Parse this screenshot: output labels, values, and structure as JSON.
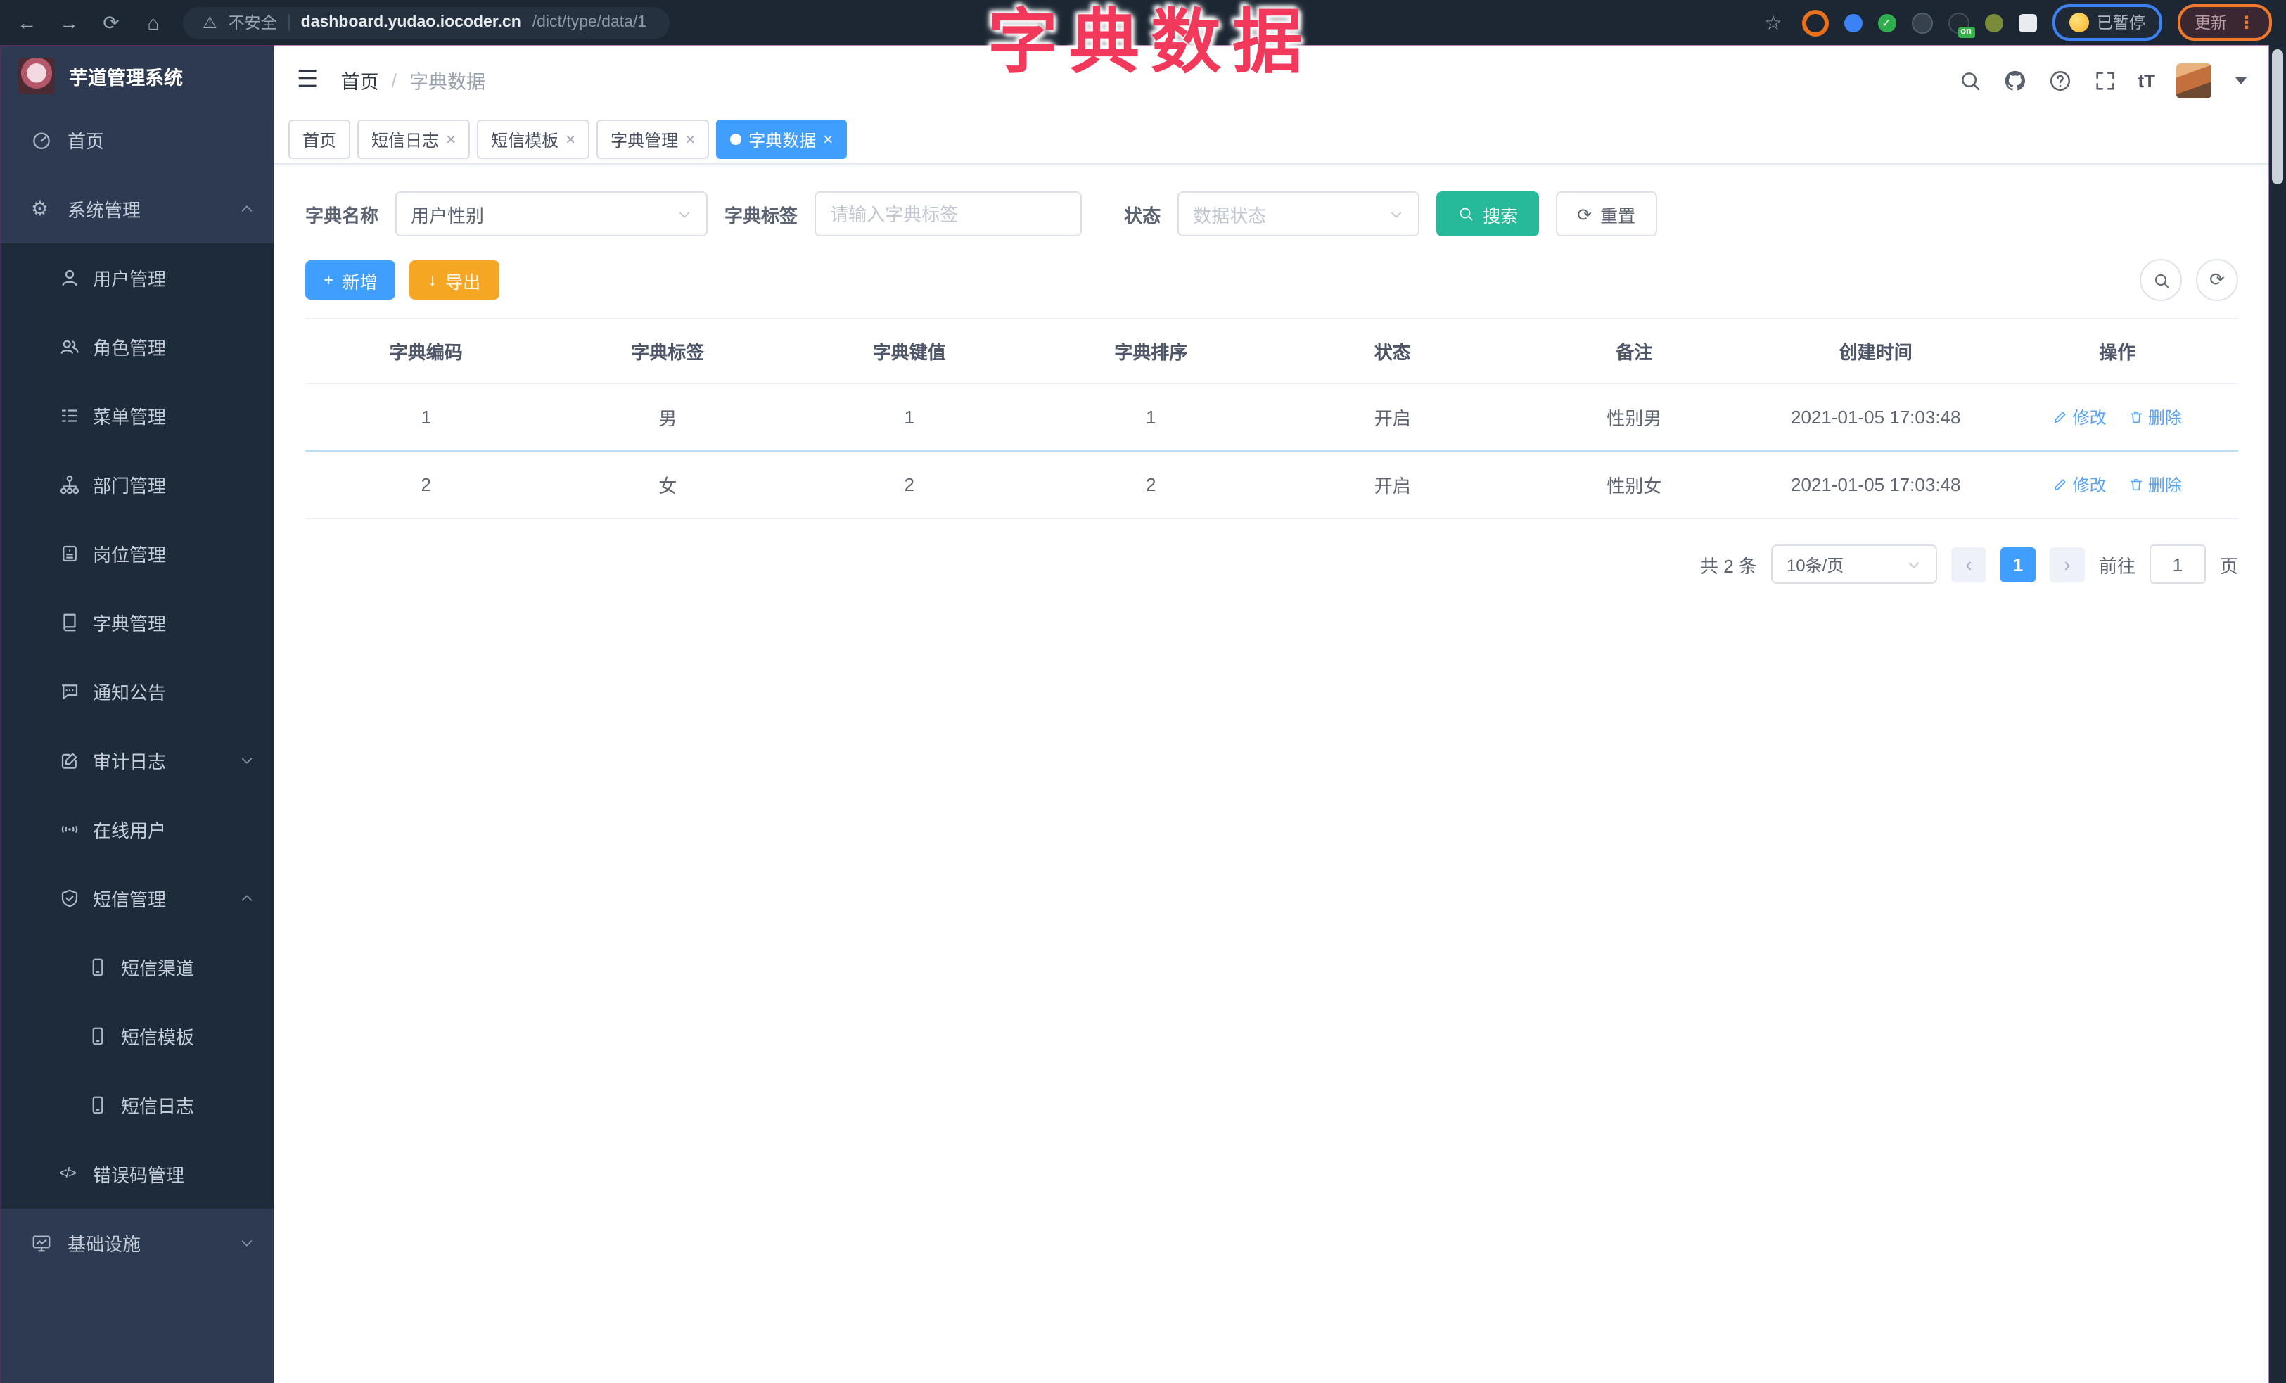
{
  "browser": {
    "security_label": "不安全",
    "url_host": "dashboard.yudao.iocoder.cn",
    "url_path": "/dict/type/data/1",
    "paused_chip": "已暂停",
    "update_button": "更新",
    "on_badge": "on"
  },
  "overlay": {
    "title": "字典数据"
  },
  "icons": {
    "back": "←",
    "forward": "→",
    "reload": "⟳",
    "home": "⌂",
    "warning": "⚠",
    "star": "☆",
    "menu_dots": "⋮",
    "hamburger": "☰",
    "gear": "⚙",
    "code": "</>",
    "check": "✓",
    "close": "×",
    "plus": "+",
    "download": "↓",
    "font_size": "tT",
    "question": "?",
    "prev": "‹",
    "next": "›"
  },
  "sidebar": {
    "app_title": "芋道管理系统",
    "items": [
      {
        "label": "首页"
      },
      {
        "label": "系统管理"
      },
      {
        "label": "用户管理"
      },
      {
        "label": "角色管理"
      },
      {
        "label": "菜单管理"
      },
      {
        "label": "部门管理"
      },
      {
        "label": "岗位管理"
      },
      {
        "label": "字典管理"
      },
      {
        "label": "通知公告"
      },
      {
        "label": "审计日志"
      },
      {
        "label": "在线用户"
      },
      {
        "label": "短信管理"
      },
      {
        "label": "短信渠道"
      },
      {
        "label": "短信模板"
      },
      {
        "label": "短信日志"
      },
      {
        "label": "错误码管理"
      },
      {
        "label": "基础设施"
      }
    ]
  },
  "header": {
    "breadcrumb_home": "首页",
    "breadcrumb_sep": "/",
    "breadcrumb_current": "字典数据"
  },
  "tabs": [
    {
      "label": "首页"
    },
    {
      "label": "短信日志"
    },
    {
      "label": "短信模板"
    },
    {
      "label": "字典管理"
    },
    {
      "label": "字典数据"
    }
  ],
  "filters": {
    "name_label": "字典名称",
    "name_value": "用户性别",
    "tag_label": "字典标签",
    "tag_placeholder": "请输入字典标签",
    "status_label": "状态",
    "status_placeholder": "数据状态",
    "search": "搜索",
    "reset": "重置"
  },
  "toolbar": {
    "add": "新增",
    "export": "导出"
  },
  "table": {
    "headers": [
      "字典编码",
      "字典标签",
      "字典键值",
      "字典排序",
      "状态",
      "备注",
      "创建时间",
      "操作"
    ],
    "rows": [
      [
        "1",
        "男",
        "1",
        "1",
        "开启",
        "性别男",
        "2021-01-05 17:03:48"
      ],
      [
        "2",
        "女",
        "2",
        "2",
        "开启",
        "性别女",
        "2021-01-05 17:03:48"
      ]
    ],
    "edit_label": "修改",
    "delete_label": "删除"
  },
  "pagination": {
    "total": "共 2 条",
    "size": "10条/页",
    "page": "1",
    "goto_prefix": "前往",
    "goto_value": "1",
    "goto_suffix": "页"
  },
  "colors": {
    "primary": "#409EFF",
    "success": "#26B99A",
    "warning": "#F5A623",
    "overlay_red": "#F2395B",
    "sidebar_light": "#2D3A51",
    "sidebar_dark": "#1D2B3B"
  }
}
